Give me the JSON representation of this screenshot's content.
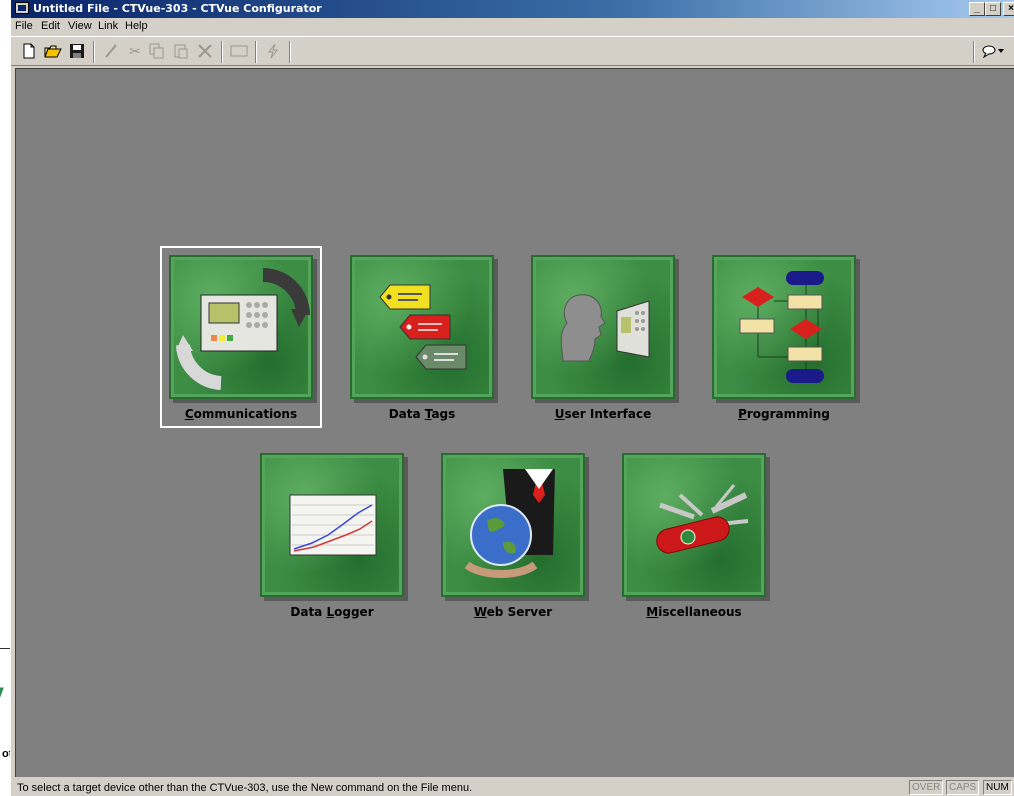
{
  "window": {
    "title": "Untitled File - CTVue-303 - CTVue Configurator",
    "controls": {
      "minimize": "_",
      "maximize": "□",
      "close": "×"
    }
  },
  "menu": [
    "File",
    "Edit",
    "View",
    "Link",
    "Help"
  ],
  "toolbar_icons": [
    "new-file-icon",
    "open-folder-icon",
    "save-icon",
    "pencil-icon",
    "cut-icon",
    "copy-icon",
    "paste-icon",
    "delete-icon",
    "rectangle-icon",
    "lightning-icon",
    "balloon-icon"
  ],
  "tiles": [
    {
      "label_pre": "",
      "label_key": "C",
      "label_post": "ommunications",
      "icon": "communications-icon",
      "selected": true
    },
    {
      "label_pre": "Data ",
      "label_key": "T",
      "label_post": "ags",
      "icon": "data-tags-icon"
    },
    {
      "label_pre": "",
      "label_key": "U",
      "label_post": "ser Interface",
      "icon": "user-interface-icon"
    },
    {
      "label_pre": "",
      "label_key": "P",
      "label_post": "rogramming",
      "icon": "programming-icon"
    },
    {
      "label_pre": "Data ",
      "label_key": "L",
      "label_post": "ogger",
      "icon": "data-logger-icon"
    },
    {
      "label_pre": "",
      "label_key": "W",
      "label_post": "eb Server",
      "icon": "web-server-icon"
    },
    {
      "label_pre": "",
      "label_key": "M",
      "label_post": "iscellaneous",
      "icon": "miscellaneous-icon"
    }
  ],
  "status": {
    "message": "To select a target device other than the CTVue-303, use the New command on the File menu.",
    "indicators": [
      "OVER",
      "CAPS",
      "NUM"
    ]
  },
  "background_window": {
    "text": "ot"
  },
  "colors": {
    "tile_green": "#3d8d45",
    "client_gray": "#808080",
    "title_blue": "#0a246a"
  }
}
